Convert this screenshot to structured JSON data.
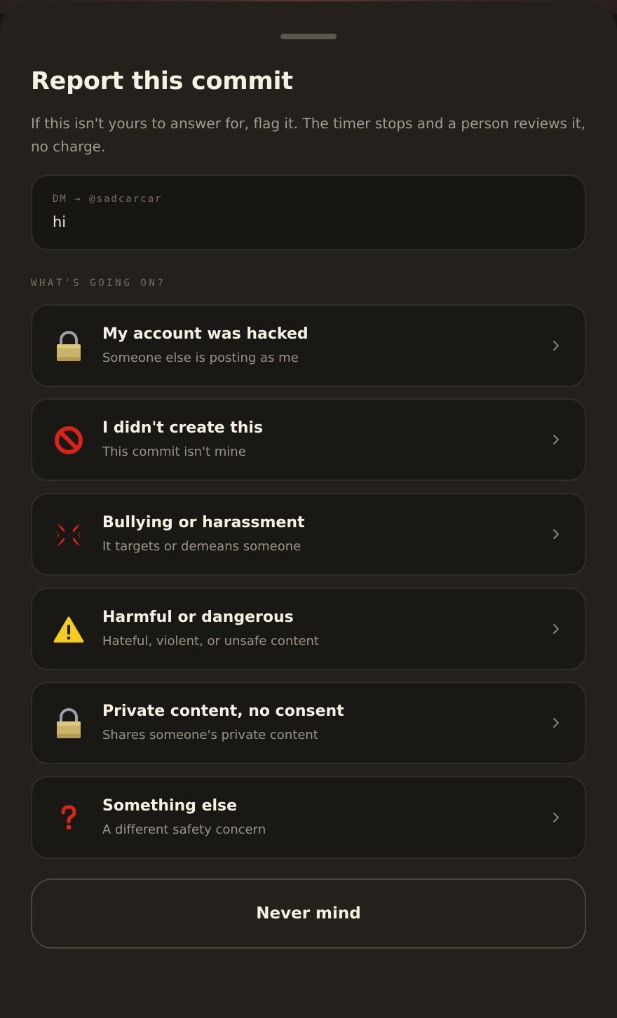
{
  "sheet": {
    "title": "Report this commit",
    "subtitle": "If this isn't yours to answer for, flag it. The timer stops and a person reviews it, no charge."
  },
  "preview": {
    "meta": "DM → @sadcarcar",
    "text": "hi"
  },
  "section_label": "WHAT'S GOING ON?",
  "options": [
    {
      "icon": "padlock-icon",
      "label": "My account was hacked",
      "desc": "Someone else is posting as me"
    },
    {
      "icon": "prohibited-icon",
      "label": "I didn't create this",
      "desc": "This commit isn't mine"
    },
    {
      "icon": "anger-symbol-icon",
      "label": "Bullying or harassment",
      "desc": "It targets or demeans someone"
    },
    {
      "icon": "warning-icon",
      "label": "Harmful or dangerous",
      "desc": "Hateful, violent, or unsafe content"
    },
    {
      "icon": "padlock-icon",
      "label": "Private content, no consent",
      "desc": "Shares someone's private content"
    },
    {
      "icon": "question-mark-icon",
      "label": "Something else",
      "desc": "A different safety concern"
    }
  ],
  "cancel_label": "Never mind",
  "colors": {
    "sheet_bg": "#24211c",
    "card_bg": "#1a1815",
    "card_border": "#302c27",
    "text_primary": "#f6f0e3",
    "text_secondary": "#9b9485",
    "icon_red": "#d9241c",
    "icon_yellow": "#f4cc1c"
  }
}
